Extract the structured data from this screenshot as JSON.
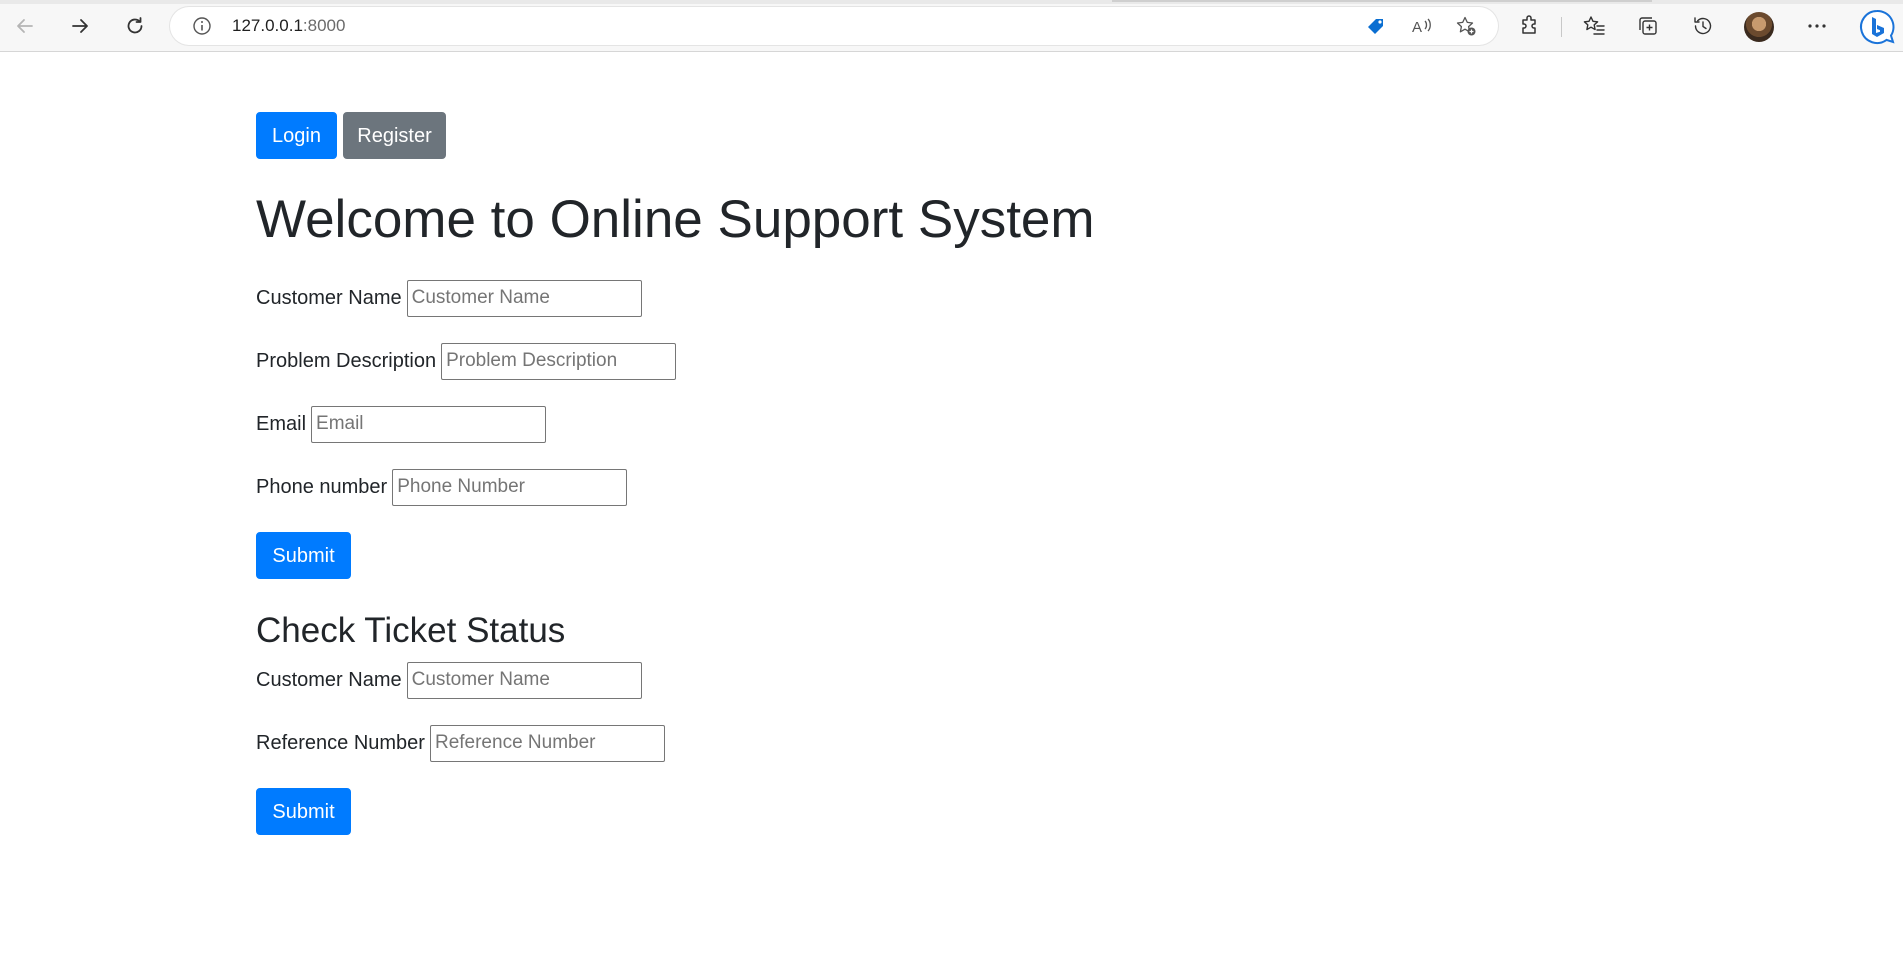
{
  "browser": {
    "url_host": "127.0.0.1",
    "url_port": ":8000",
    "icons": {
      "back": "arrow-left-icon",
      "forward": "arrow-right-icon",
      "refresh": "refresh-icon",
      "info": "info-icon",
      "shopping": "tag-icon",
      "read_aloud": "read-aloud-icon",
      "add_favorite": "star-add-icon",
      "extensions": "puzzle-icon",
      "favorites": "favorites-list-icon",
      "collections": "collections-icon",
      "history": "history-icon",
      "more": "more-icon",
      "bing": "bing-chat-icon"
    },
    "accent_color": "#0a6ed1"
  },
  "header_buttons": {
    "login_label": "Login",
    "register_label": "Register"
  },
  "main": {
    "title": "Welcome to Online Support System",
    "ticket_form": {
      "customer_name_label": "Customer Name",
      "customer_name_placeholder": "Customer Name",
      "problem_label": "Problem Description",
      "problem_placeholder": "Problem Description",
      "email_label": "Email",
      "email_placeholder": "Email",
      "phone_label": "Phone number",
      "phone_placeholder": "Phone Number",
      "submit_label": "Submit"
    },
    "status_section": {
      "title": "Check Ticket Status",
      "customer_name_label": "Customer Name",
      "customer_name_placeholder": "Customer Name",
      "reference_label": "Reference Number",
      "reference_placeholder": "Reference Number",
      "submit_label": "Submit"
    }
  },
  "colors": {
    "primary": "#007bff",
    "secondary": "#6c757d",
    "text": "#212529"
  }
}
